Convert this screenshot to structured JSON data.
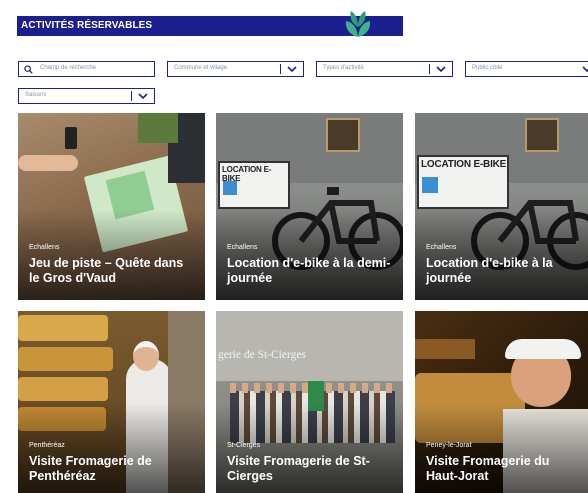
{
  "header": {
    "title": "ACTIVITÉS RÉSERVABLES",
    "logo_icon": "leaf-logo-icon",
    "brand_color": "#1b1f8f",
    "logo_color": "#3fb28c"
  },
  "filters": {
    "search_placeholder": "Champ de recherche",
    "commune_placeholder": "Commune et village",
    "type_placeholder": "Types d'activité",
    "public_placeholder": "Public cible",
    "season_placeholder": "Saisons"
  },
  "cards": [
    {
      "location": "Echallens",
      "title": "Jeu de piste – Quête dans le Gros d'Vaud"
    },
    {
      "location": "Echallens",
      "title": "Location d'e-bike à la demi-journée"
    },
    {
      "location": "Echallens",
      "title": "Location d'e-bike à la journée"
    },
    {
      "location": "Penthéréaz",
      "title": "Visite Fromagerie de Penthéréaz"
    },
    {
      "location": "St-Cierges",
      "title": "Visite Fromagerie de St-Cierges"
    },
    {
      "location": "Peney-le-Jorat",
      "title": "Visite Fromagerie du Haut-Jorat"
    }
  ],
  "photo_text": {
    "ebike_sign": "LOCATION E-BIKE",
    "shop_sign": "gerie de St-Cierges"
  }
}
